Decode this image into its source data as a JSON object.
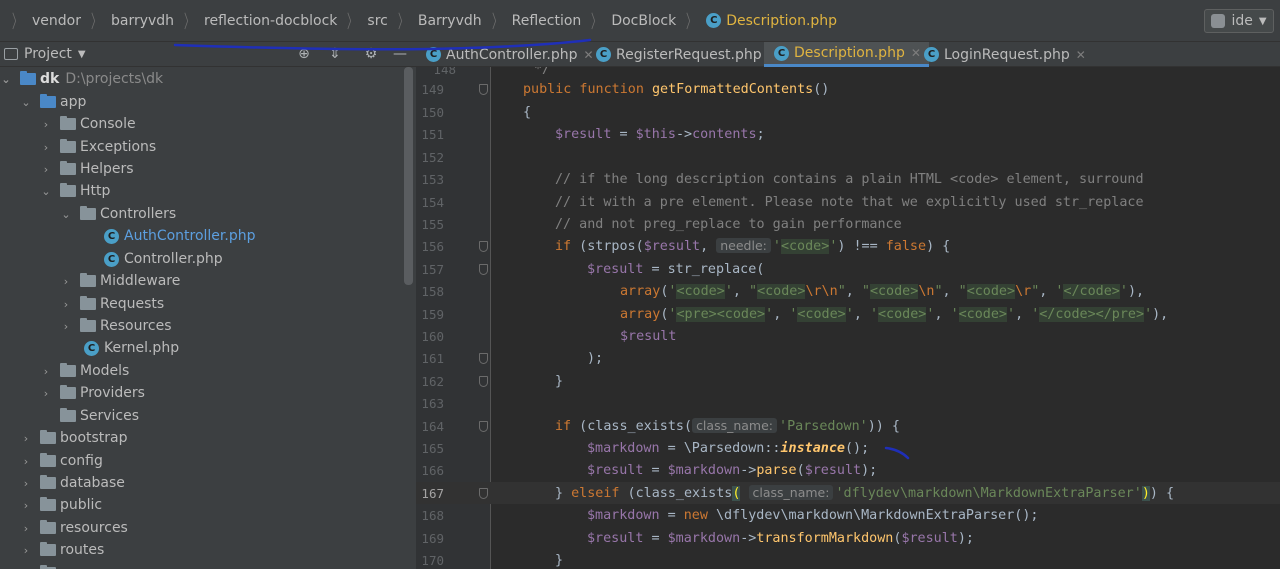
{
  "breadcrumb": {
    "items": [
      "vendor",
      "barryvdh",
      "reflection-docblock",
      "src",
      "Barryvdh",
      "Reflection",
      "DocBlock"
    ],
    "current_file": "Description.php"
  },
  "ide_button": {
    "label": "ide"
  },
  "project_panel": {
    "label": "Project"
  },
  "tabs": [
    {
      "label": "AuthController.php"
    },
    {
      "label": "RegisterRequest.php"
    },
    {
      "label": "Description.php",
      "active": true
    },
    {
      "label": "LoginRequest.php"
    }
  ],
  "tree": {
    "root": {
      "label": "dk",
      "path": "D:\\projects\\dk"
    },
    "items": [
      {
        "label": "app"
      },
      {
        "label": "Console"
      },
      {
        "label": "Exceptions"
      },
      {
        "label": "Helpers"
      },
      {
        "label": "Http"
      },
      {
        "label": "Controllers"
      },
      {
        "label": "AuthController.php"
      },
      {
        "label": "Controller.php"
      },
      {
        "label": "Middleware"
      },
      {
        "label": "Requests"
      },
      {
        "label": "Resources"
      },
      {
        "label": "Kernel.php"
      },
      {
        "label": "Models"
      },
      {
        "label": "Providers"
      },
      {
        "label": "Services"
      },
      {
        "label": "bootstrap"
      },
      {
        "label": "config"
      },
      {
        "label": "database"
      },
      {
        "label": "public"
      },
      {
        "label": "resources"
      },
      {
        "label": "routes"
      }
    ]
  },
  "editor": {
    "line_numbers": [
      "148",
      "149",
      "150",
      "151",
      "152",
      "153",
      "154",
      "155",
      "156",
      "157",
      "158",
      "159",
      "160",
      "161",
      "162",
      "163",
      "164",
      "165",
      "166",
      "167",
      "168",
      "169",
      "170"
    ],
    "current_line": "167",
    "hints": {
      "needle": "needle:",
      "class_name": "class_name:"
    }
  },
  "colors": {
    "keyword": "#cc7832",
    "function": "#ffc66d",
    "variable": "#9876aa",
    "comment": "#808080",
    "string": "#6a8759",
    "accent": "#4a88c7",
    "active_file": "#e0b440"
  }
}
